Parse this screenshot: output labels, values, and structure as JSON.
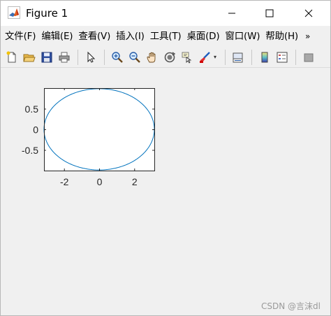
{
  "window": {
    "title": "Figure 1"
  },
  "menu": {
    "items": [
      "文件(F)",
      "编辑(E)",
      "查看(V)",
      "插入(I)",
      "工具(T)",
      "桌面(D)",
      "窗口(W)",
      "帮助(H)"
    ],
    "overflow_label": "»"
  },
  "toolbar": {
    "icons": [
      "new-figure-icon",
      "open-file-icon",
      "save-icon",
      "print-icon",
      "select-arrow-icon",
      "zoom-in-icon",
      "zoom-out-icon",
      "pan-hand-icon",
      "rotate-3d-icon",
      "data-cursor-icon",
      "brush-icon",
      "link-plot-icon",
      "colorbar-icon",
      "legend-icon",
      "property-editor-icon"
    ]
  },
  "chart_data": {
    "type": "line",
    "title": "",
    "xlabel": "",
    "ylabel": "",
    "xlim": [
      -3.14159,
      3.14159
    ],
    "ylim": [
      -1,
      1
    ],
    "xticks": [
      -2,
      0,
      2
    ],
    "yticks": [
      -0.5,
      0,
      0.5
    ],
    "xtick_labels": [
      "-2",
      "0",
      "2"
    ],
    "ytick_labels": [
      "-0.5",
      "0",
      "0.5"
    ],
    "grid": false,
    "series": [
      {
        "description": "ellipse x = pi*cos(t), y = sin(t)",
        "color": "#0072bd",
        "x": [
          3.1416,
          2.9521,
          2.4067,
          1.5708,
          0.5455,
          -0.5455,
          -1.5708,
          -2.4067,
          -2.9521,
          -3.1416,
          -2.9521,
          -2.4067,
          -1.5708,
          -0.5455,
          0.5455,
          1.5708,
          2.4067,
          2.9521,
          3.1416
        ],
        "y": [
          0,
          0.342,
          0.6428,
          0.866,
          0.9848,
          0.9848,
          0.866,
          0.6428,
          0.342,
          0,
          -0.342,
          -0.6428,
          -0.866,
          -0.9848,
          -0.9848,
          -0.866,
          -0.6428,
          -0.342,
          0
        ]
      }
    ]
  },
  "watermark": "CSDN @言沫dl",
  "colors": {
    "line": "#0072bd",
    "axes_bg": "#ffffff",
    "figure_bg": "#f0f0f0"
  }
}
